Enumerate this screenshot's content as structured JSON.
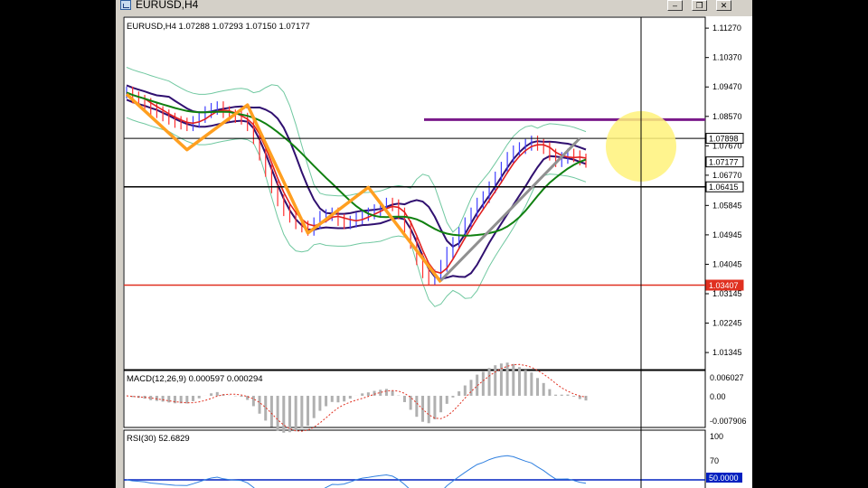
{
  "window": {
    "title": "EURUSD,H4",
    "buttons": {
      "minimize": "‒",
      "restore": "❐",
      "close": "✕"
    }
  },
  "colors": {
    "price_bars": "#4040ff",
    "price_bars_down": "#ff3030",
    "zigzag": "#ff9f20",
    "ma_fast": "#e02020",
    "ma_slow": "#108010",
    "bands_outer": "#70c8a0",
    "bands_inner": "#301070",
    "resistance_line": "#7a1a8a",
    "support_line": "#e03020",
    "trend_line": "#909090",
    "highlight": "#fff27a",
    "rsi_line": "#3080e0",
    "rsi_level": "#0020c0"
  },
  "main_panel": {
    "header": "EURUSD,H4  1.07288 1.07293 1.07150 1.07177",
    "y_ticks": [
      "1.11270",
      "1.10370",
      "1.09470",
      "1.08570",
      "1.07670",
      "1.06770",
      "1.05845",
      "1.04945",
      "1.04045",
      "1.03145",
      "1.02245",
      "1.01345"
    ],
    "price_tags": [
      {
        "text": "1.07898",
        "value": 1.07898,
        "style": "outline"
      },
      {
        "text": "1.07177",
        "value": 1.07177,
        "style": "outline"
      },
      {
        "text": "1.06415",
        "value": 1.06415,
        "style": "outline"
      },
      {
        "text": "1.03407",
        "value": 1.03407,
        "style": "red"
      }
    ]
  },
  "macd_panel": {
    "header": "MACD(12,26,9) 0.000597 0.000294",
    "y_ticks": [
      "0.006027",
      "0.00",
      "-0.007906"
    ]
  },
  "rsi_panel": {
    "header": "RSI(30) 52.6829",
    "y_ticks": [
      "100",
      "70"
    ],
    "level_tag": "50.0000"
  },
  "chart_data": {
    "type": "line",
    "symbol": "EURUSD",
    "timeframe": "H4",
    "ohlc_last": {
      "open": 1.07288,
      "high": 1.07293,
      "low": 1.0715,
      "close": 1.07177
    },
    "ylim": [
      1.0085,
      1.1155
    ],
    "close_series": [
      1.093,
      1.0915,
      1.0905,
      1.0895,
      1.088,
      1.087,
      1.086,
      1.085,
      1.084,
      1.0835,
      1.083,
      1.084,
      1.0855,
      1.087,
      1.088,
      1.0885,
      1.087,
      1.086,
      1.0855,
      1.085,
      1.083,
      1.079,
      1.074,
      1.069,
      1.064,
      1.06,
      1.057,
      1.055,
      1.053,
      1.052,
      1.051,
      1.053,
      1.055,
      1.0555,
      1.056,
      1.054,
      1.053,
      1.0535,
      1.0545,
      1.0555,
      1.056,
      1.057,
      1.058,
      1.059,
      1.0585,
      1.056,
      1.052,
      1.047,
      1.042,
      1.038,
      1.036,
      1.037,
      1.04,
      1.044,
      1.047,
      1.05,
      1.053,
      1.056,
      1.059,
      1.061,
      1.064,
      1.067,
      1.07,
      1.073,
      1.075,
      1.076,
      1.077,
      1.078,
      1.077,
      1.076,
      1.074,
      1.072,
      1.073,
      1.074,
      1.0735,
      1.0725,
      1.0718
    ],
    "horizontal_levels": [
      1.0847,
      1.07898,
      1.06415,
      1.03407
    ],
    "zigzag_points": [
      [
        0,
        1.0925
      ],
      [
        10,
        1.0755
      ],
      [
        20,
        1.0892
      ],
      [
        30,
        1.05
      ],
      [
        40,
        1.064
      ],
      [
        52,
        1.035
      ]
    ],
    "trend_line": [
      [
        52,
        1.0355
      ],
      [
        75,
        1.079
      ]
    ],
    "macd_range": [
      -0.007906,
      0.006027
    ],
    "rsi_range": [
      0,
      100
    ],
    "rsi_level": 50
  }
}
